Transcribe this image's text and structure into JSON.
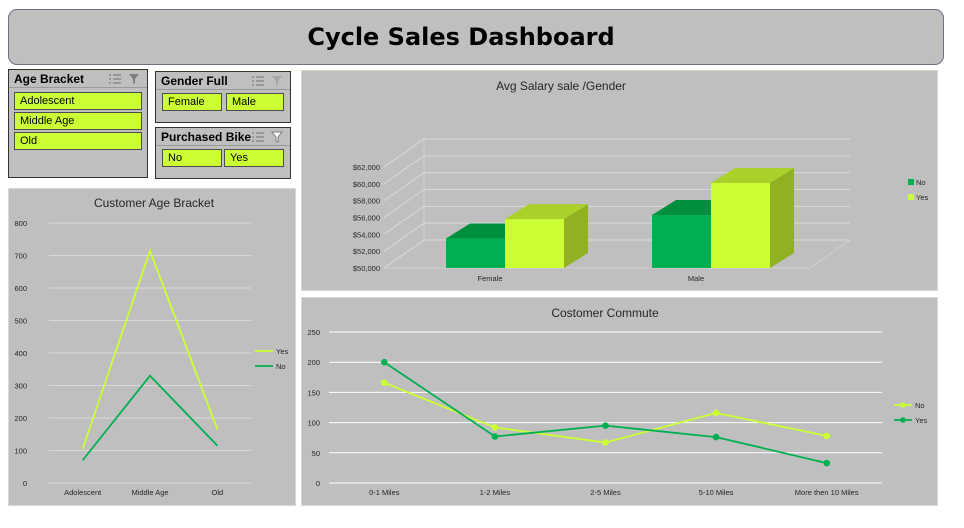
{
  "header": {
    "title": "Cycle Sales Dashboard"
  },
  "slicers": {
    "age": {
      "title": "Age Bracket",
      "items": [
        "Adolescent",
        "Middle Age",
        "Old"
      ]
    },
    "gender": {
      "title": "Gender Full",
      "items": [
        "Female",
        "Male"
      ]
    },
    "purchased": {
      "title": "Purchased Bike",
      "items": [
        "No",
        "Yes"
      ]
    }
  },
  "colors": {
    "yes_light": "#ccff33",
    "no_green": "#00b050",
    "panel_bg": "#bfbfbf"
  },
  "chart_data": [
    {
      "type": "line",
      "title": "Customer Age Bracket",
      "categories": [
        "Adolescent",
        "Middle Age",
        "Old"
      ],
      "series": [
        {
          "name": "Yes",
          "values": [
            105,
            715,
            165
          ]
        },
        {
          "name": "No",
          "values": [
            70,
            330,
            115
          ]
        }
      ],
      "ylim": [
        0,
        800
      ],
      "yticks": [
        "0",
        "100",
        "200",
        "300",
        "400",
        "500",
        "600",
        "700",
        "800"
      ],
      "grid": true,
      "legend": "right"
    },
    {
      "type": "bar",
      "title": "Avg Salary sale /Gender",
      "categories": [
        "Female",
        "Male"
      ],
      "series": [
        {
          "name": "No",
          "values": [
            53500,
            56300
          ]
        },
        {
          "name": "Yes",
          "values": [
            55800,
            60100
          ]
        }
      ],
      "ylim": [
        50000,
        62000
      ],
      "yticks": [
        "$50,000",
        "$52,000",
        "$54,000",
        "$56,000",
        "$58,000",
        "$60,000",
        "$62,000"
      ],
      "grid": true,
      "legend": "right",
      "style": "3d"
    },
    {
      "type": "line",
      "title": "Costomer Commute",
      "categories": [
        "0-1 Miles",
        "1-2 Miles",
        "2-5 Miles",
        "5-10 Miles",
        "More then 10 Miles"
      ],
      "series": [
        {
          "name": "No",
          "values": [
            166,
            92,
            67,
            116,
            78
          ]
        },
        {
          "name": "Yes",
          "values": [
            200,
            77,
            95,
            76,
            33
          ]
        }
      ],
      "ylim": [
        0,
        250
      ],
      "yticks": [
        "0",
        "50",
        "100",
        "150",
        "200",
        "250"
      ],
      "grid": true,
      "legend": "right",
      "markers": true
    }
  ]
}
